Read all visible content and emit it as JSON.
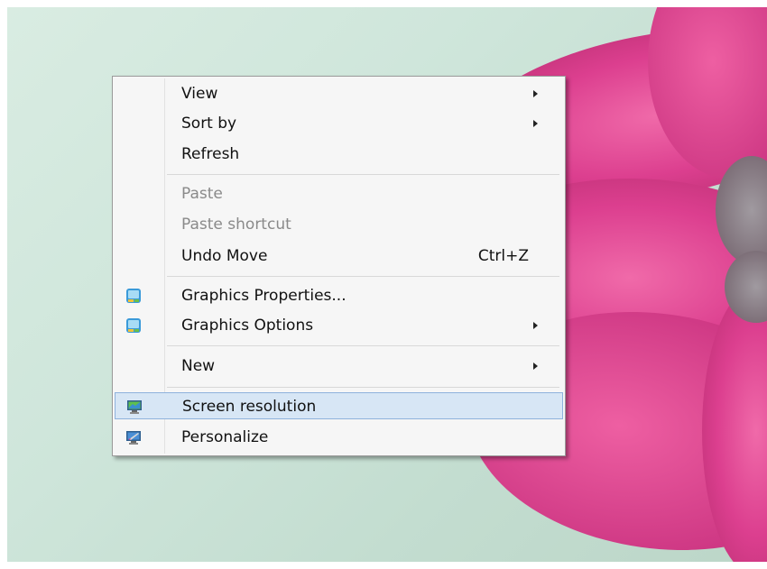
{
  "menu": {
    "items": [
      {
        "label": "View",
        "submenu": true
      },
      {
        "label": "Sort by",
        "submenu": true
      },
      {
        "label": "Refresh"
      },
      {
        "label": "Paste",
        "disabled": true
      },
      {
        "label": "Paste shortcut",
        "disabled": true
      },
      {
        "label": "Undo Move",
        "shortcut": "Ctrl+Z"
      },
      {
        "label": "Graphics Properties...",
        "icon": "intel-graphics-icon"
      },
      {
        "label": "Graphics Options",
        "icon": "intel-graphics-icon",
        "submenu": true
      },
      {
        "label": "New",
        "submenu": true
      },
      {
        "label": "Screen resolution",
        "icon": "monitor-icon",
        "highlighted": true
      },
      {
        "label": "Personalize",
        "icon": "personalize-icon"
      }
    ]
  },
  "colors": {
    "highlight": "#d7e6f5",
    "highlight_border": "#8eb2dc",
    "disabled_text": "#8a8a8a",
    "flower_pink": "#e0479a"
  }
}
